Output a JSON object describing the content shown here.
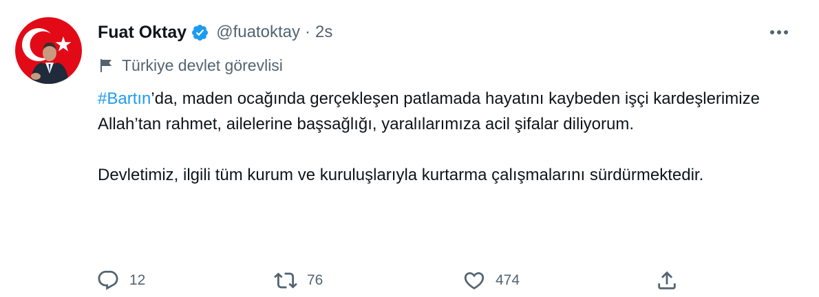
{
  "author": {
    "name": "Fuat Oktay",
    "handle": "@fuatoktay",
    "separator": "·",
    "time": "2s",
    "verified": true,
    "avatar_icon": "profile-photo-with-turkish-flag"
  },
  "label": {
    "icon": "flag-icon",
    "text": "Türkiye devlet görevlisi"
  },
  "tweet": {
    "hashtag": "#Bartın",
    "paragraph1_rest": "’da, maden ocağında gerçekleşen patlamada hayatını kaybeden işçi kardeşlerimize Allah’tan rahmet, ailelerine başsağlığı, yaralılarımıza acil şifalar diliyorum.",
    "paragraph2": "Devletimiz, ilgili tüm kurum ve kuruluşlarıyla kurtarma çalışmalarını sürdürmektedir."
  },
  "actions": {
    "reply": {
      "icon": "reply-icon",
      "count": "12"
    },
    "retweet": {
      "icon": "retweet-icon",
      "count": "76"
    },
    "like": {
      "icon": "heart-icon",
      "count": "474"
    },
    "share": {
      "icon": "share-icon"
    }
  },
  "colors": {
    "text": "#0f1419",
    "secondary": "#536471",
    "accent": "#1d9bf0",
    "avatar_red": "#e30a17"
  }
}
